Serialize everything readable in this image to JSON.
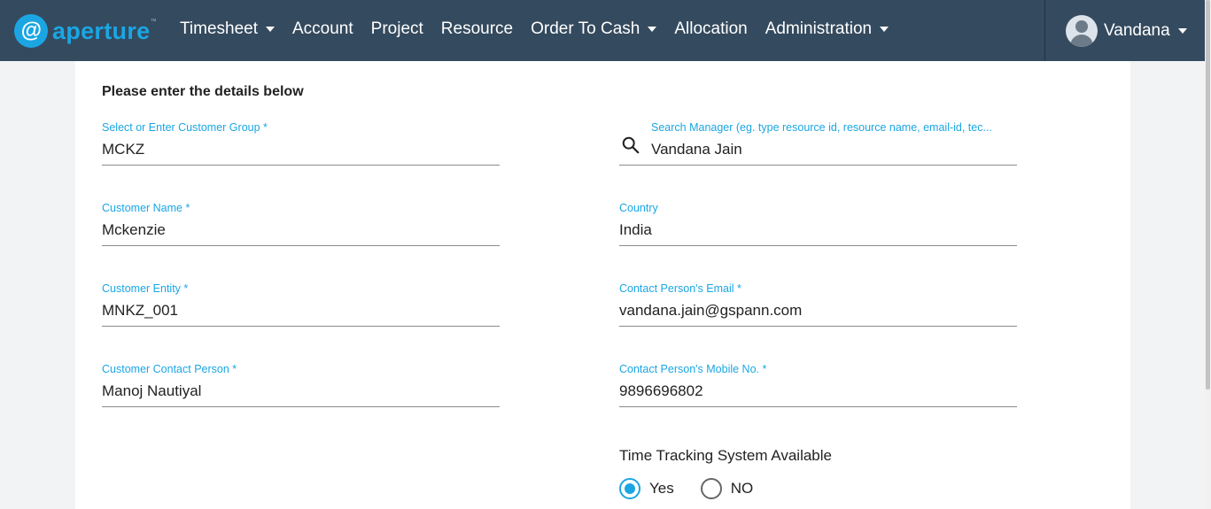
{
  "brand": {
    "logo_glyph": "@",
    "name": "aperture",
    "tm": "™",
    "accent_color": "#1ba6e3",
    "navbar_color": "#344a5e"
  },
  "nav": [
    {
      "label": "Timesheet",
      "dropdown": true
    },
    {
      "label": "Account",
      "dropdown": false
    },
    {
      "label": "Project",
      "dropdown": false
    },
    {
      "label": "Resource",
      "dropdown": false
    },
    {
      "label": "Order To Cash",
      "dropdown": true
    },
    {
      "label": "Allocation",
      "dropdown": false
    },
    {
      "label": "Administration",
      "dropdown": true
    }
  ],
  "user": {
    "name": "Vandana",
    "avatar_icon": "user-avatar-icon"
  },
  "form": {
    "title": "Please enter the details below",
    "customer_group": {
      "label": "Select or Enter Customer Group *",
      "value": "MCKZ"
    },
    "customer_name": {
      "label": "Customer Name *",
      "value": "Mckenzie"
    },
    "customer_entity": {
      "label": "Customer Entity *",
      "value": "MNKZ_001"
    },
    "customer_contact": {
      "label": "Customer Contact Person *",
      "value": "Manoj Nautiyal"
    },
    "manager": {
      "label": "Search Manager (eg. type resource id, resource name, email-id, tec...",
      "value": "Vandana Jain",
      "icon": "search-icon"
    },
    "country": {
      "label": "Country",
      "value": "India"
    },
    "contact_email": {
      "label": "Contact Person's Email *",
      "value": "vandana.jain@gspann.com"
    },
    "contact_mobile": {
      "label": "Contact Person's Mobile No. *",
      "value": "9896696802"
    },
    "time_tracking": {
      "label": "Time Tracking System Available",
      "options": [
        {
          "label": "Yes",
          "checked": true
        },
        {
          "label": "NO",
          "checked": false
        }
      ]
    }
  }
}
